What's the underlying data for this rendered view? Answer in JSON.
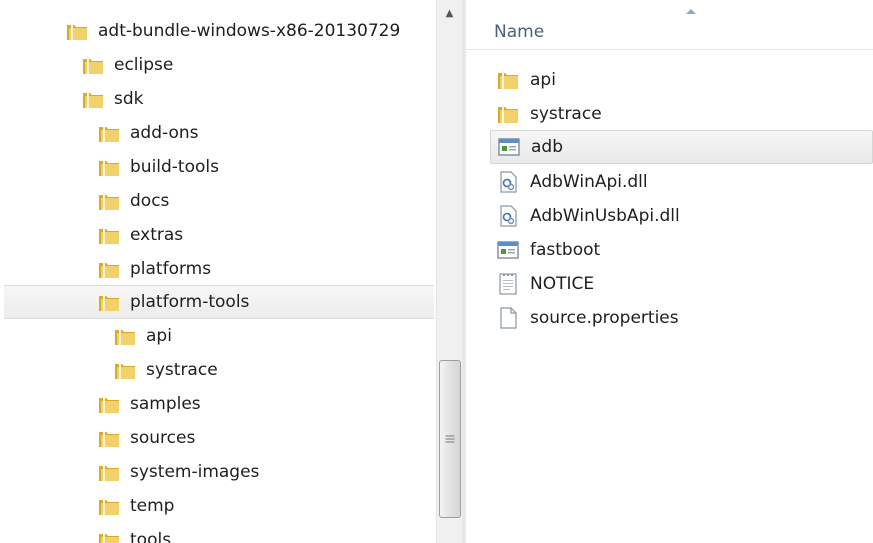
{
  "tree": {
    "items": [
      {
        "label": "adt-bundle-windows-x86-20130729",
        "icon": "folder-icon"
      },
      {
        "label": "eclipse",
        "icon": "folder-icon"
      },
      {
        "label": "sdk",
        "icon": "folder-icon"
      },
      {
        "label": "add-ons",
        "icon": "folder-icon"
      },
      {
        "label": "build-tools",
        "icon": "folder-icon"
      },
      {
        "label": "docs",
        "icon": "folder-icon"
      },
      {
        "label": "extras",
        "icon": "folder-icon"
      },
      {
        "label": "platforms",
        "icon": "folder-icon"
      },
      {
        "label": "platform-tools",
        "icon": "folder-icon",
        "selected": true
      },
      {
        "label": "api",
        "icon": "folder-icon"
      },
      {
        "label": "systrace",
        "icon": "folder-icon"
      },
      {
        "label": "samples",
        "icon": "folder-icon"
      },
      {
        "label": "sources",
        "icon": "folder-icon"
      },
      {
        "label": "system-images",
        "icon": "folder-icon"
      },
      {
        "label": "temp",
        "icon": "folder-icon"
      },
      {
        "label": "tools",
        "icon": "folder-icon"
      }
    ]
  },
  "file_list": {
    "column_header": "Name",
    "items": [
      {
        "name": "api",
        "icon": "folder-icon"
      },
      {
        "name": "systrace",
        "icon": "folder-icon"
      },
      {
        "name": "adb",
        "icon": "application-icon",
        "selected": true
      },
      {
        "name": "AdbWinApi.dll",
        "icon": "dll-icon"
      },
      {
        "name": "AdbWinUsbApi.dll",
        "icon": "dll-icon"
      },
      {
        "name": "fastboot",
        "icon": "application-icon"
      },
      {
        "name": "NOTICE",
        "icon": "text-file-icon"
      },
      {
        "name": "source.properties",
        "icon": "blank-file-icon"
      }
    ]
  },
  "colors": {
    "folder_yellow": "#e8c04a",
    "selection_bg": "#ececec",
    "header_text": "#4c607a"
  }
}
